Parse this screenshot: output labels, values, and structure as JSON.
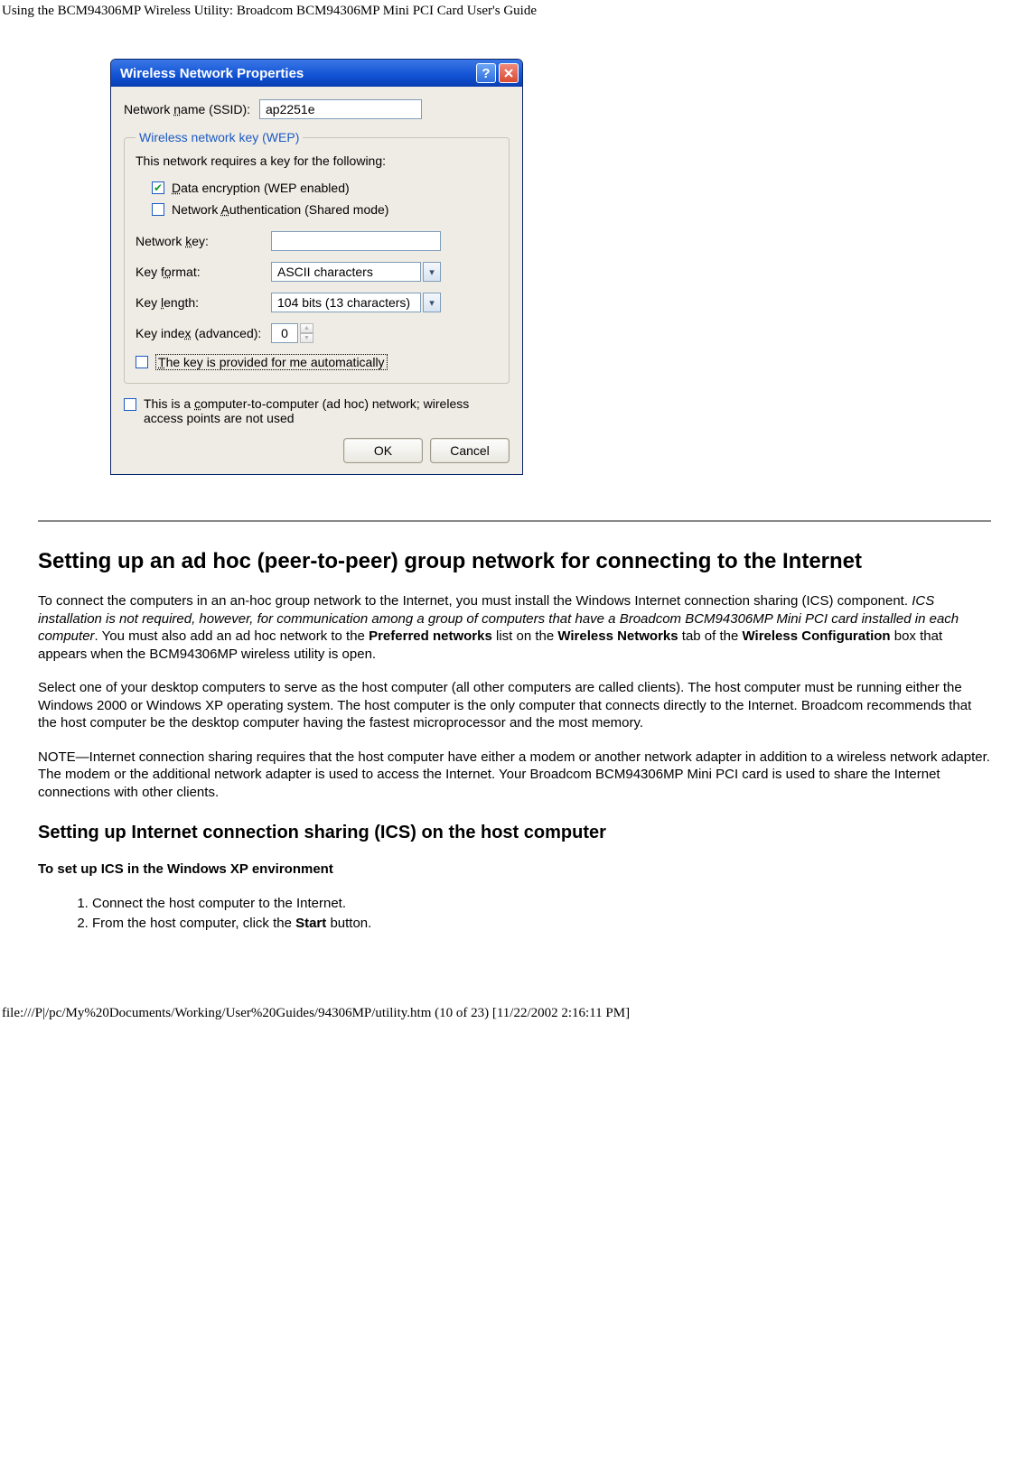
{
  "page_header": "Using the BCM94306MP Wireless Utility: Broadcom BCM94306MP Mini PCI Card User's Guide",
  "footer": "file:///P|/pc/My%20Documents/Working/User%20Guides/94306MP/utility.htm (10 of 23) [11/22/2002 2:16:11 PM]",
  "dialog": {
    "title": "Wireless Network Properties",
    "ssid_label": "Network name (SSID):",
    "ssid_value": "ap2251e",
    "wep_legend": "Wireless network key (WEP)",
    "requires_text": "This network requires a key for the following:",
    "cb_data_enc": "Data encryption (WEP enabled)",
    "cb_net_auth": "Network Authentication (Shared mode)",
    "net_key_label": "Network key:",
    "key_format_label": "Key format:",
    "key_format_value": "ASCII characters",
    "key_length_label": "Key length:",
    "key_length_value": "104 bits (13 characters)",
    "key_index_label": "Key index (advanced):",
    "key_index_value": "0",
    "cb_auto_key": "The key is provided for me automatically",
    "cb_adhoc": "This is a computer-to-computer (ad hoc) network; wireless access points are not used",
    "ok": "OK",
    "cancel": "Cancel"
  },
  "doc": {
    "h2": "Setting up an ad hoc (peer-to-peer) group network for connecting to the Internet",
    "p1a": "To connect the computers in an an-hoc group network to the Internet, you must install the Windows Internet connection sharing (ICS) component. ",
    "p1b_italic": "ICS installation is not required, however, for communication among a group of computers that have a Broadcom BCM94306MP Mini PCI card installed in each computer",
    "p1c": ". You must also add an ad hoc network to the ",
    "p1d_bold": "Preferred networks",
    "p1e": " list on the ",
    "p1f_bold": "Wireless Networks",
    "p1g": " tab of the ",
    "p1h_bold": "Wireless Configuration",
    "p1i": " box that appears when the BCM94306MP wireless utility is open.",
    "p2": "Select one of your desktop computers to serve as the host computer (all other computers are called clients). The host computer must be running either the Windows 2000 or Windows XP operating system. The host computer is the only computer that connects directly to the Internet. Broadcom recommends that the host computer be the desktop computer having the fastest microprocessor and the most memory.",
    "p3": "NOTE—Internet connection sharing requires that the host computer have either a modem or another network adapter in addition to a wireless network adapter. The modem or the additional network adapter is used to access the Internet. Your Broadcom BCM94306MP Mini PCI card is used to share the Internet connections with other clients.",
    "h3": "Setting up Internet connection sharing (ICS) on the host computer",
    "h4": "To set up ICS in the Windows XP environment",
    "step1": "Connect the host computer to the Internet.",
    "step2a": "From the host computer, click the ",
    "step2b_bold": "Start",
    "step2c": " button."
  }
}
